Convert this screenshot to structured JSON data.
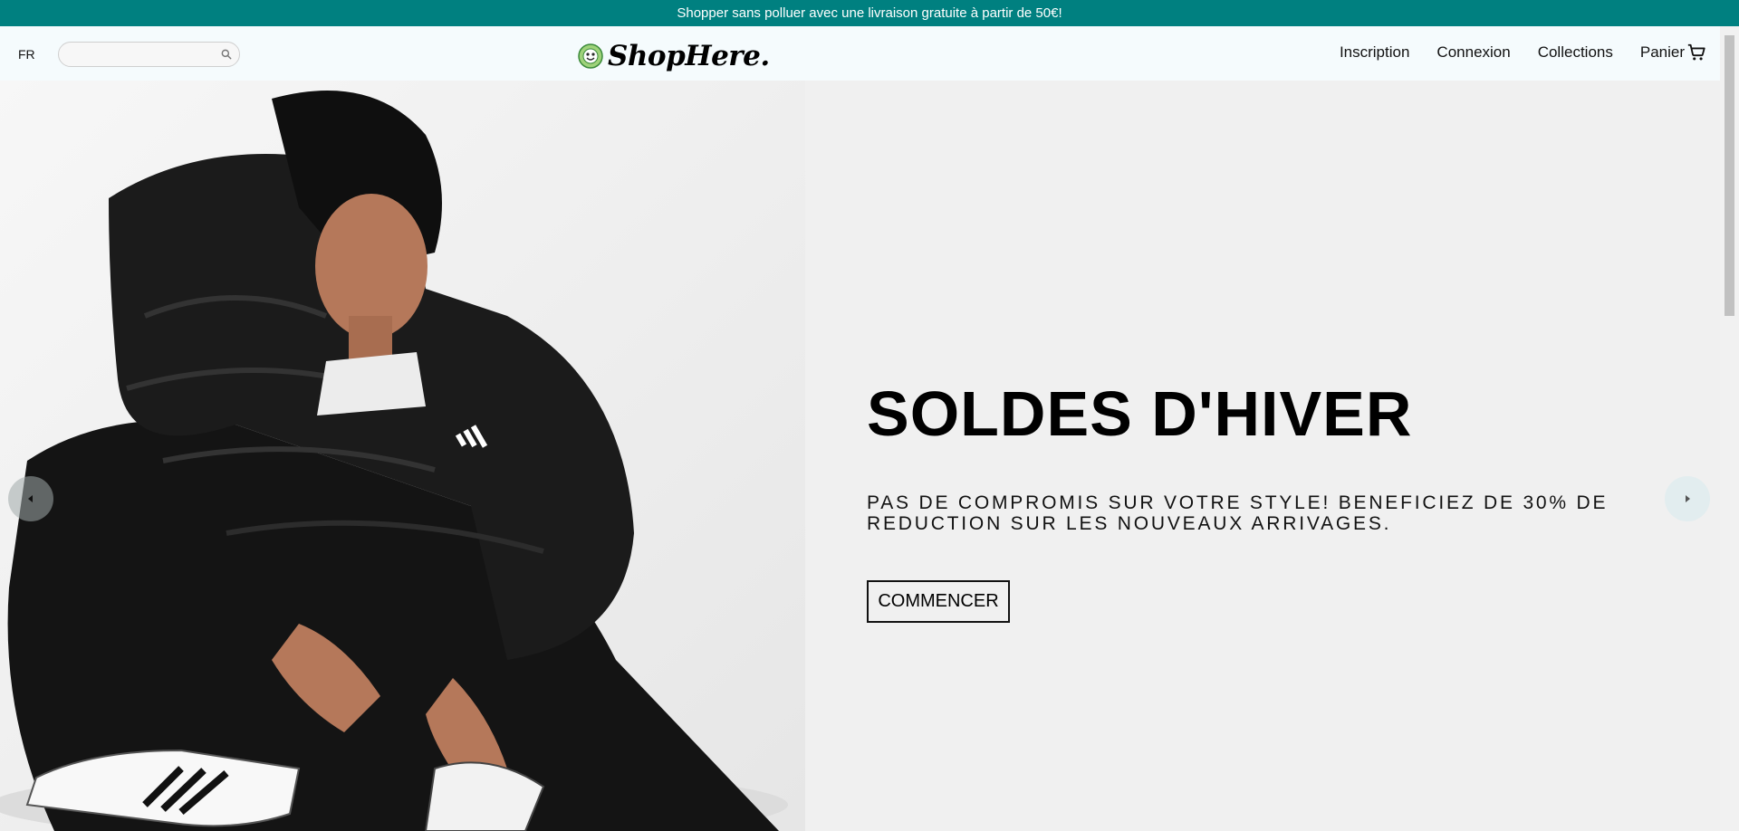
{
  "announcement": {
    "text": "Shopper sans polluer avec une livraison gratuite à partir de 50€!"
  },
  "header": {
    "language": "FR",
    "search": {
      "placeholder": "",
      "value": ""
    },
    "logo_text": "ShopHere.",
    "nav": {
      "signup": "Inscription",
      "login": "Connexion",
      "collections": "Collections",
      "cart": "Panier"
    }
  },
  "hero": {
    "title": "SOLDES D'HIVER",
    "description": "PAS DE COMPROMIS SUR VOTRE STYLE! BENEFICIEZ DE 30% DE REDUCTION SUR LES NOUVEAUX ARRIVAGES.",
    "cta": "COMMENCER"
  },
  "colors": {
    "announcement_bg": "#008080",
    "navbar_bg": "#f5fbfd",
    "hero_bg": "#f0f0f0",
    "text": "#000000"
  },
  "icons": {
    "search": "search-icon",
    "cart": "cart-icon",
    "prev": "chevron-left-icon",
    "next": "chevron-right-icon",
    "logo": "logo-mark-icon"
  }
}
